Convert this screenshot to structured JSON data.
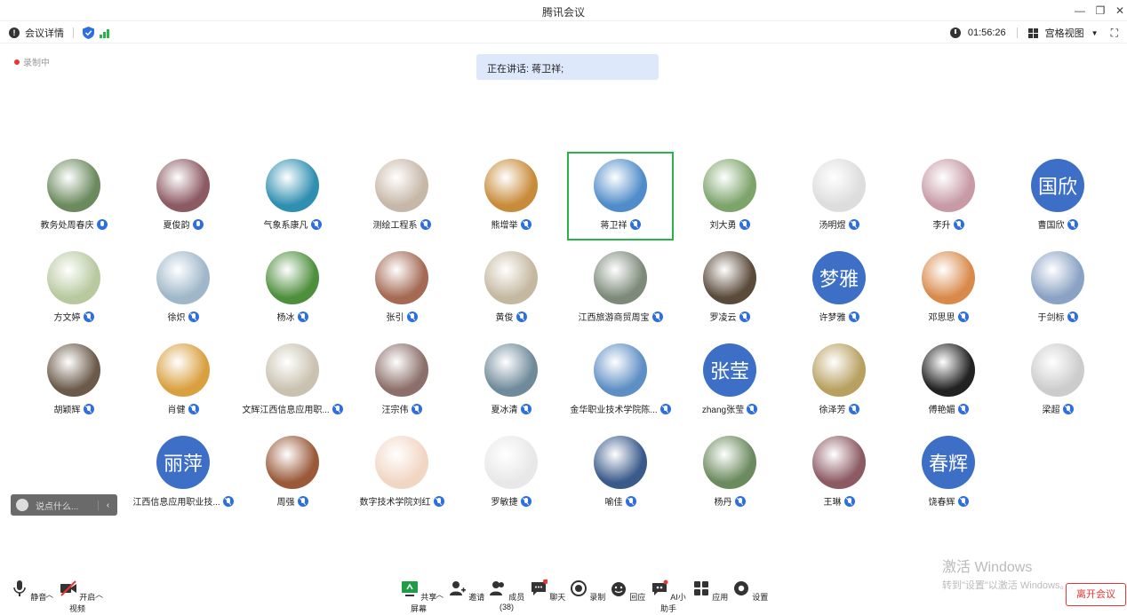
{
  "window": {
    "title": "腾讯会议"
  },
  "infobar": {
    "meeting_details": "会议详情",
    "timer": "01:56:26",
    "view_mode": "宫格视图"
  },
  "recording": {
    "label": "录制中"
  },
  "speaking": {
    "text": "正在讲话: 蒋卫祥;"
  },
  "participants": [
    {
      "name": "教务处周春庆"
    },
    {
      "name": "夏俊韵"
    },
    {
      "name": "气象系康凡"
    },
    {
      "name": "测绘工程系"
    },
    {
      "name": "熊增举"
    },
    {
      "name": "蒋卫祥"
    },
    {
      "name": "刘大勇"
    },
    {
      "name": "汤明煜"
    },
    {
      "name": "李升"
    },
    {
      "name": "曹国欣",
      "avatar_text": "国欣"
    },
    {
      "name": "方文婷"
    },
    {
      "name": "徐炽"
    },
    {
      "name": "杨冰"
    },
    {
      "name": "张引"
    },
    {
      "name": "黄俊"
    },
    {
      "name": "江西旅游商贸周宝"
    },
    {
      "name": "罗凌云"
    },
    {
      "name": "许梦雅",
      "avatar_text": "梦雅"
    },
    {
      "name": "邓思思"
    },
    {
      "name": "于剑标"
    },
    {
      "name": "胡颖辉"
    },
    {
      "name": "肖健"
    },
    {
      "name": "文辉江西信息应用职..."
    },
    {
      "name": "汪宗伟"
    },
    {
      "name": "夏冰清"
    },
    {
      "name": "金华职业技术学院陈..."
    },
    {
      "name": "zhang张莹",
      "avatar_text": "张莹"
    },
    {
      "name": "徐泽芳"
    },
    {
      "name": "傅艳媚"
    },
    {
      "name": "梁超"
    },
    {
      "name": "江西信息应用职业技...",
      "avatar_text": "丽萍"
    },
    {
      "name": "周强"
    },
    {
      "name": "数字技术学院刘红"
    },
    {
      "name": "罗敏捷"
    },
    {
      "name": "喻佳"
    },
    {
      "name": "杨丹"
    },
    {
      "name": "王琳"
    },
    {
      "name": "饶春辉",
      "avatar_text": "春辉"
    }
  ],
  "chat": {
    "placeholder": "说点什么..."
  },
  "watermark": {
    "line1": "激活 Windows",
    "line2": "转到\"设置\"以激活 Windows。"
  },
  "toolbar": {
    "mute": "静音",
    "video": "开启视频",
    "share": "共享屏幕",
    "invite": "邀请",
    "members": "成员(38)",
    "chat": "聊天",
    "record": "录制",
    "react": "回应",
    "ai": "AI小助手",
    "apps": "应用",
    "settings": "设置",
    "leave": "离开会议"
  },
  "colors": {
    "accent": "#2d6fe0",
    "active_border": "#2ab34b",
    "danger": "#e33333",
    "avatar_text_bg": "#3e6fc7"
  }
}
